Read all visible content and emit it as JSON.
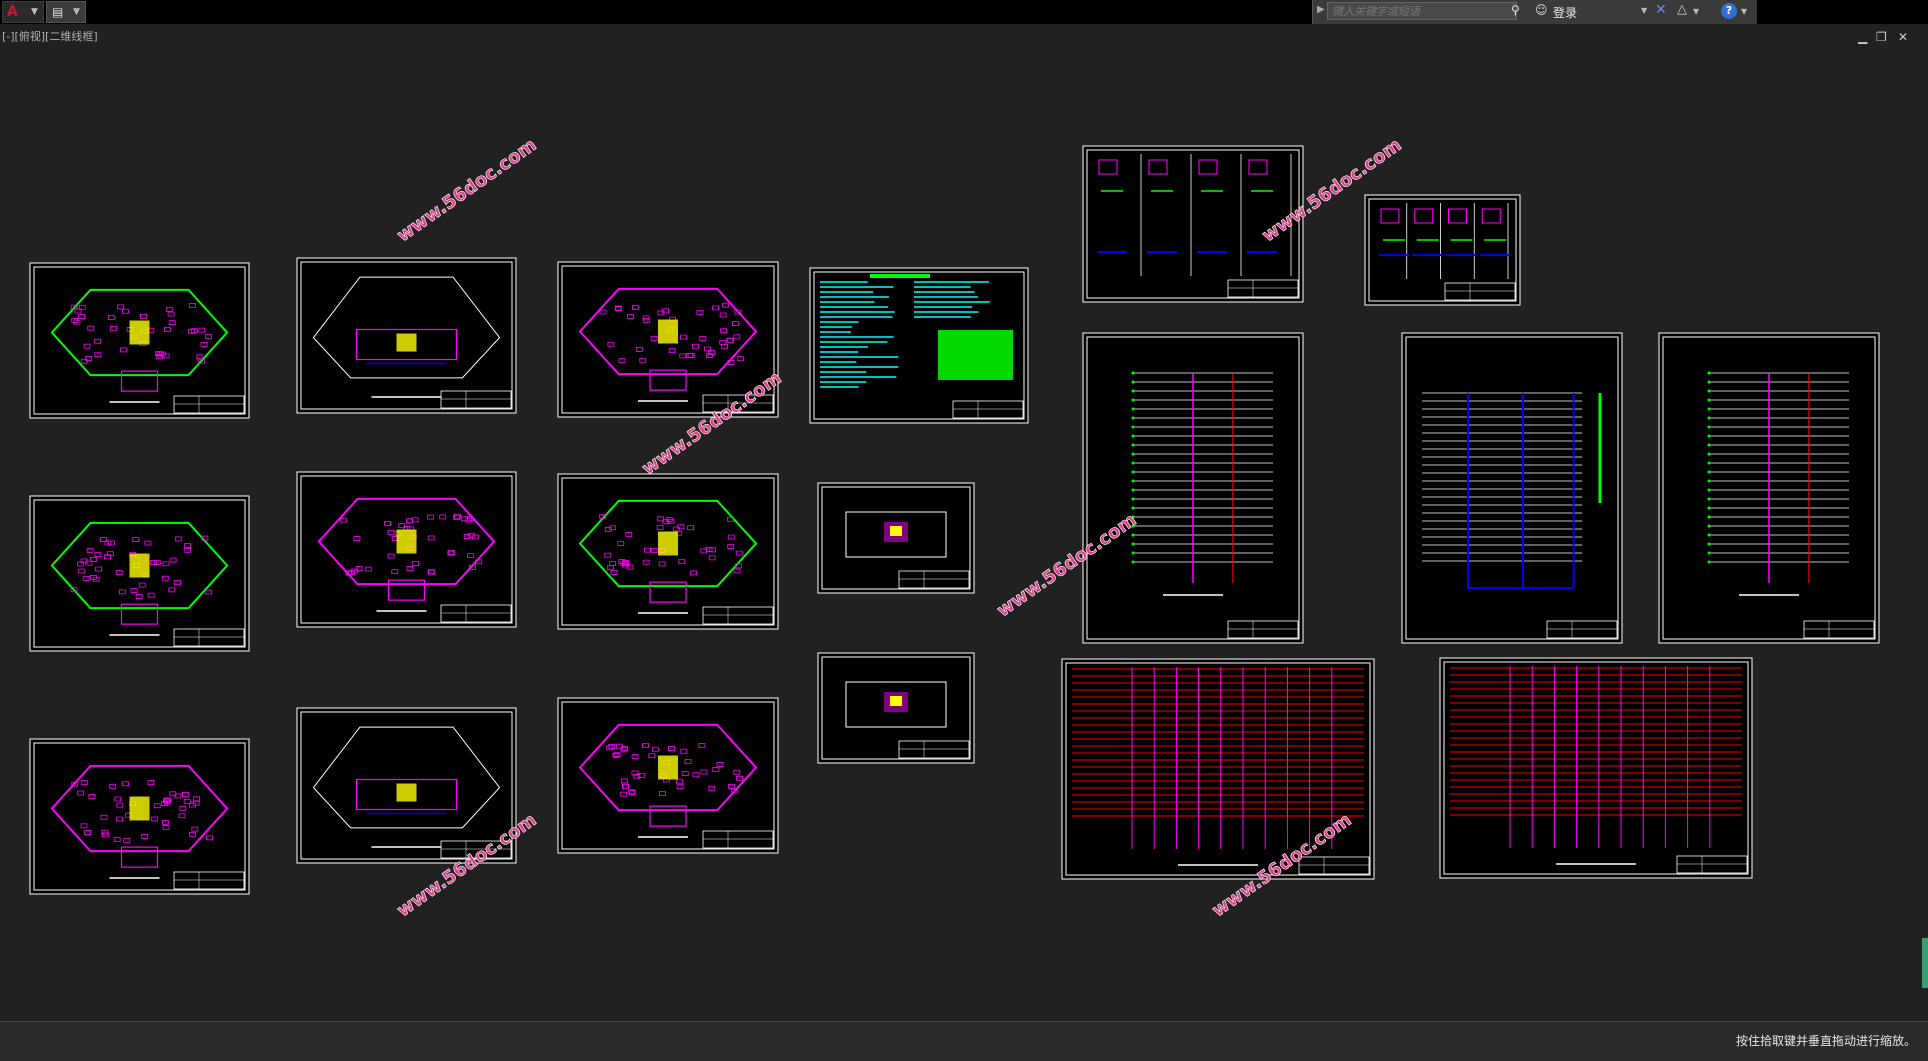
{
  "toolbar": {
    "app_menu_icon": "autocad-logo-icon",
    "quick_access_icon": "document-edit-icon"
  },
  "infocenter": {
    "search_placeholder": "键入关键字或短语",
    "login_label": "登录"
  },
  "viewport": {
    "label": "[-][俯视][二维线框]"
  },
  "statusbar": {
    "prompt": "按住拾取键并垂直拖动进行缩放。"
  },
  "watermark": "www.56doc.com",
  "colors": {
    "background": "#212121",
    "sheet_border": "#ffffff",
    "magenta": "#ff00ff",
    "green": "#00ff00",
    "yellow": "#ffff00",
    "cyan": "#00ffff",
    "blue": "#0000ff",
    "red": "#ff0000",
    "watermark": "#e0408a"
  }
}
